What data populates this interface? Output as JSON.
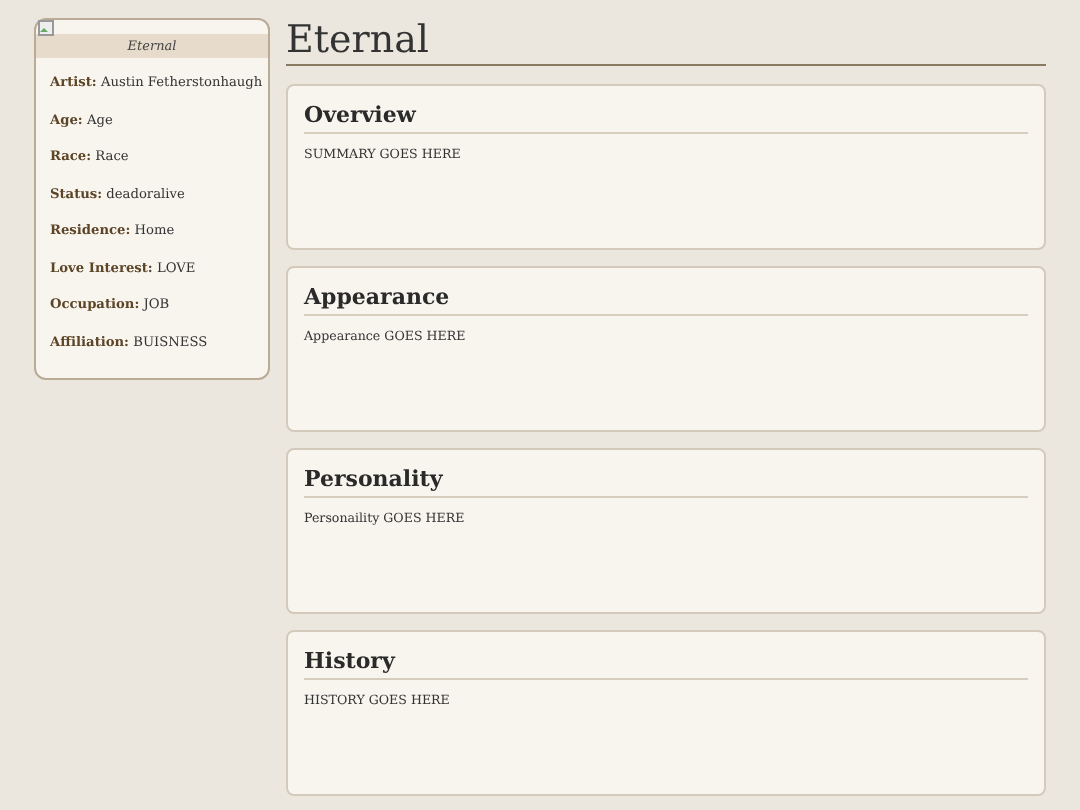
{
  "infobox": {
    "caption": "Eternal",
    "fields": [
      {
        "label": "Artist:",
        "value": "Austin Fetherstonhaugh"
      },
      {
        "label": "Age:",
        "value": "Age"
      },
      {
        "label": "Race:",
        "value": "Race"
      },
      {
        "label": "Status:",
        "value": "deadoralive"
      },
      {
        "label": "Residence:",
        "value": "Home"
      },
      {
        "label": "Love Interest:",
        "value": "LOVE"
      },
      {
        "label": "Occupation:",
        "value": "JOB"
      },
      {
        "label": "Affiliation:",
        "value": "BUISNESS"
      }
    ]
  },
  "page_title": "Eternal",
  "sections": [
    {
      "heading": "Overview",
      "body": "SUMMARY GOES HERE"
    },
    {
      "heading": "Appearance",
      "body": "Appearance GOES HERE"
    },
    {
      "heading": "Personality",
      "body": "Personaility GOES HERE"
    },
    {
      "heading": "History",
      "body": "HISTORY GOES HERE"
    }
  ]
}
